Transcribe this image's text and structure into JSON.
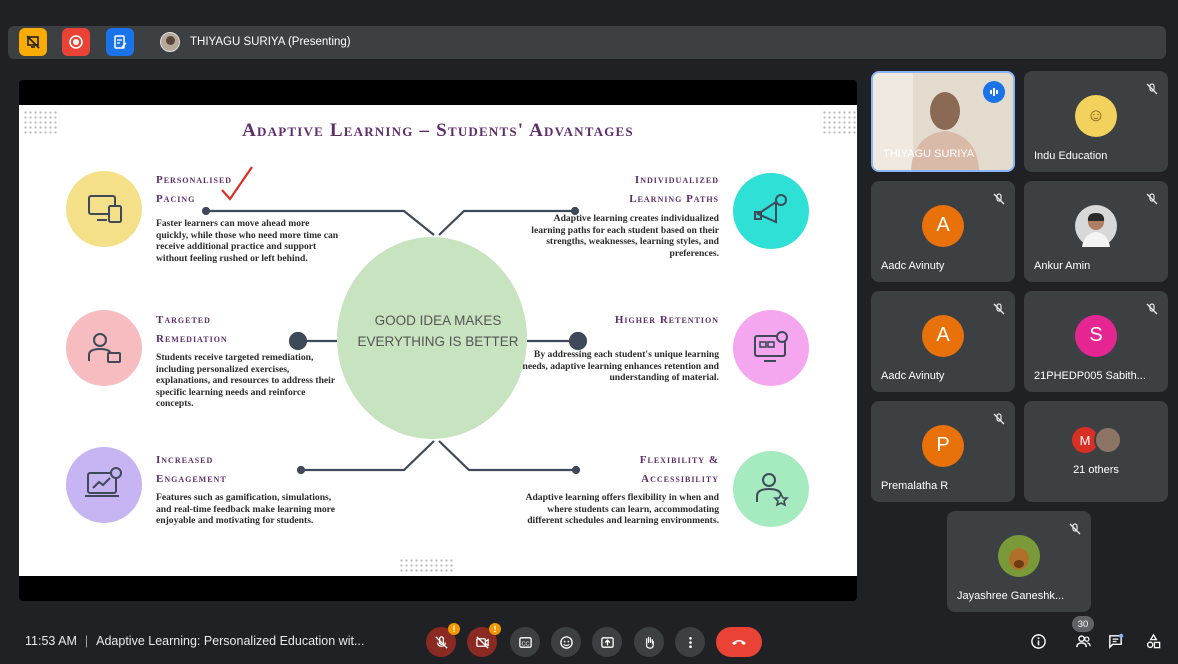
{
  "top_bar": {
    "presenter_label": "THIYAGU SURIYA (Presenting)",
    "buttons": [
      {
        "name": "pin-off",
        "color": "#f9ab00"
      },
      {
        "name": "record",
        "color": "#ea4335"
      },
      {
        "name": "add-note",
        "color": "#1a73e8"
      }
    ]
  },
  "slide": {
    "title": "Adaptive Learning – Students' Advantages",
    "center_text": "GOOD IDEA MAKES EVERYTHING IS BETTER",
    "sections": [
      {
        "title_line1": "Personalised",
        "title_line2": "Pacing",
        "body": "Faster learners can move ahead more quickly, while those who need more time can receive additional practice and support without feeling rushed or left behind.",
        "icon": "computer-icon",
        "color": "#f5e08a"
      },
      {
        "title_line1": "Targeted",
        "title_line2": "Remediation",
        "body": "Students receive targeted remediation, including personalized exercises, explanations, and resources to address their specific learning needs and reinforce concepts.",
        "icon": "teacher-icon",
        "color": "#f7bcc0"
      },
      {
        "title_line1": "Increased",
        "title_line2": "Engagement",
        "body": "Features such as gamification, simulations, and real-time feedback make learning more enjoyable and motivating for students.",
        "icon": "analytics-screen-icon",
        "color": "#c6b4f3"
      },
      {
        "title_line1": "Individualized",
        "title_line2": "Learning Paths",
        "body": "Adaptive learning creates individualized learning paths for each student based on their strengths, weaknesses, learning styles, and preferences.",
        "icon": "megaphone-gear-icon",
        "color": "#2ee0d6"
      },
      {
        "title_line1": "Higher Retention",
        "title_line2": "",
        "body": "By addressing each student's unique learning needs, adaptive learning enhances retention and understanding of material.",
        "icon": "monitor-icon",
        "color": "#f4a7ee"
      },
      {
        "title_line1": "Flexibility &",
        "title_line2": "Accessibility",
        "body": "Adaptive learning offers flexibility in when and where students can learn, accommodating different schedules and learning environments.",
        "icon": "person-star-icon",
        "color": "#a6ebc0"
      }
    ]
  },
  "participants": [
    {
      "name": "THIYAGU SURIYA",
      "type": "video",
      "speaking": true
    },
    {
      "name": "Indu Education",
      "initial": "",
      "avatar_color": "#f2d15c",
      "muted": true
    },
    {
      "name": "Aadc Avinuty",
      "initial": "A",
      "avatar_color": "#e8710a",
      "muted": true
    },
    {
      "name": "Ankur Amin",
      "initial": "",
      "avatar_color": "#c9c9c9",
      "muted": true
    },
    {
      "name": "Aadc Avinuty",
      "initial": "A",
      "avatar_color": "#e8710a",
      "muted": true
    },
    {
      "name": "21PHEDP005 Sabith...",
      "initial": "S",
      "avatar_color": "#e52592",
      "muted": true
    },
    {
      "name": "Premalatha R",
      "initial": "P",
      "avatar_color": "#e8710a",
      "muted": true
    },
    {
      "name": "21 others",
      "initial": "M",
      "avatar_color": "#d93025",
      "muted": false
    },
    {
      "name": "Jayashree Ganeshk...",
      "initial": "",
      "avatar_color": "#7a9a3a",
      "muted": true
    }
  ],
  "bottom_bar": {
    "time": "11:53 AM",
    "meeting_title": "Adaptive Learning: Personalized Education wit...",
    "participant_count": "30",
    "controls": [
      "mic-off",
      "camera-off",
      "captions",
      "emoji",
      "present",
      "raise-hand",
      "more-options",
      "leave-call"
    ],
    "right_controls": [
      "meeting-details",
      "people",
      "chat",
      "activities"
    ]
  }
}
